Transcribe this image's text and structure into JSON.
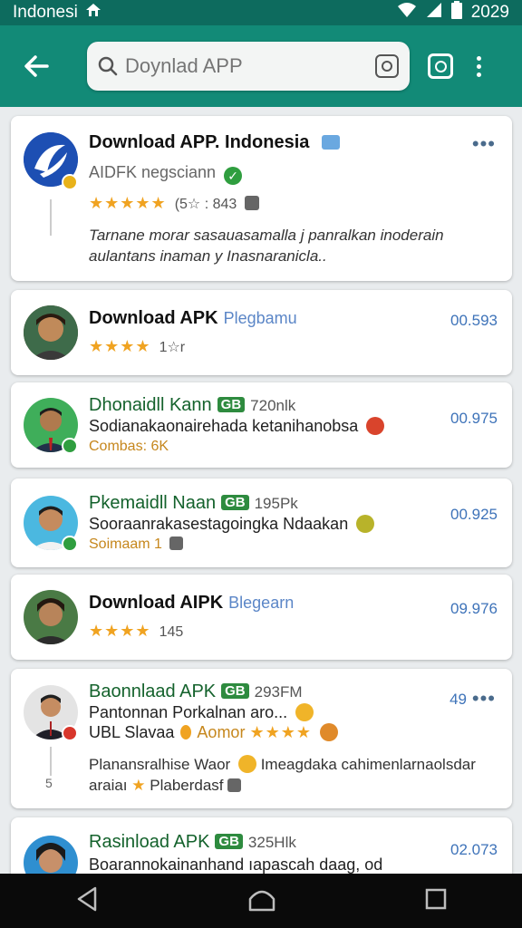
{
  "status": {
    "carrier": "Indonesi",
    "time": "2029"
  },
  "search": {
    "placeholder": "Doynlad APP"
  },
  "cards": [
    {
      "title": "Download APP. Indonesia",
      "subtitle": "AIDFK negsciann",
      "rating_text": "(5☆ : 843",
      "desc1": "Tarnane morar sasauasamalla j panralkan inoderain",
      "desc2": "aulantans inaman y Inasnaranicla..",
      "more": "•••",
      "stars": "★★★★★"
    },
    {
      "title": "Download APK",
      "tag": "Plegbamu",
      "meta": "1☆r",
      "value": "00.593",
      "stars": "★★★★"
    },
    {
      "title": "Dhonaidll Kann",
      "badge": "GB",
      "size": "720nlk",
      "line": "Sodianakaonairehada ketanihanobsa",
      "meta": "Combas: 6K",
      "value": "00.975"
    },
    {
      "title": "Pkemaidll Naan",
      "badge": "GB",
      "size": "195Pk",
      "line": "Sooraanrakasestagoingka Ndaakan",
      "meta": "Soimaam 1",
      "value": "00.925"
    },
    {
      "title": "Download AIPK",
      "tag": "Blegearn",
      "meta": "145",
      "value": "09.976",
      "stars": "★★★★"
    },
    {
      "title": "Baonnlaad APK",
      "badge": "GB",
      "size": "293FM",
      "line1": "Pantonnan Porkalnan aro...",
      "line2_a": "UBL Slavaa",
      "line2_b": "Aomor",
      "line2_stars": "★★★★",
      "desc1": "Planansralhise Waor",
      "desc1b": "Imeagdaka cahimenlarnaolsdar",
      "desc2": "araiaı",
      "desc2b": "Plaberdasf",
      "value": "49",
      "more": "•••",
      "side": "5"
    },
    {
      "title": "Rasinload APK",
      "badge": "GB",
      "size": "325Hlk",
      "line": "Boarannokainanhand ıapascah daag, od",
      "value": "02.073"
    }
  ]
}
